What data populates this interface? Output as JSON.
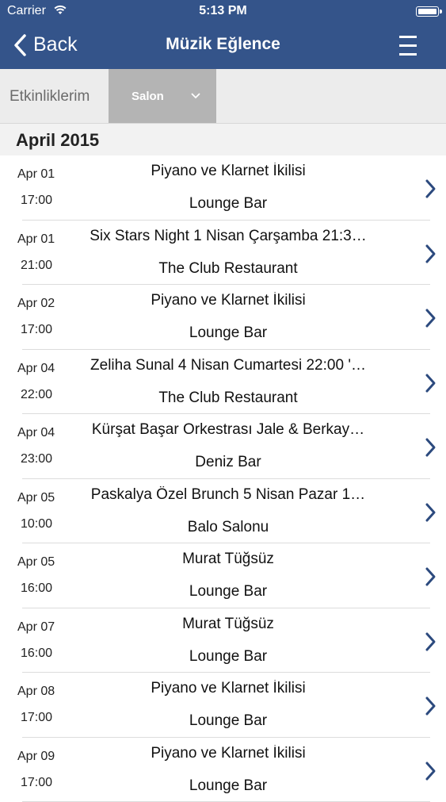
{
  "status_bar": {
    "carrier": "Carrier",
    "time": "5:13 PM"
  },
  "nav": {
    "back_label": "Back",
    "title": "Müzik Eğlence"
  },
  "tabs": {
    "etkinliklerim": "Etkinliklerim",
    "salon": "Salon"
  },
  "section": {
    "title": "April 2015"
  },
  "events": [
    {
      "date": "Apr 01",
      "time": "17:00",
      "name": "Piyano ve Klarnet İkilisi",
      "venue": "Lounge Bar"
    },
    {
      "date": "Apr 01",
      "time": "21:00",
      "name": "Six Stars Night 1 Nisan Çarşamba 21:3…",
      "venue": "The Club Restaurant"
    },
    {
      "date": "Apr 02",
      "time": "17:00",
      "name": "Piyano ve Klarnet İkilisi",
      "venue": "Lounge Bar"
    },
    {
      "date": "Apr 04",
      "time": "22:00",
      "name": "Zeliha Sunal 4 Nisan Cumartesi 22:00 '…",
      "venue": "The Club Restaurant"
    },
    {
      "date": "Apr 04",
      "time": "23:00",
      "name": "Kürşat Başar Orkestrası Jale & Berkay…",
      "venue": "Deniz Bar"
    },
    {
      "date": "Apr 05",
      "time": "10:00",
      "name": "Paskalya Özel Brunch 5 Nisan Pazar 1…",
      "venue": "Balo Salonu"
    },
    {
      "date": "Apr 05",
      "time": "16:00",
      "name": "Murat Tüğsüz",
      "venue": "Lounge Bar"
    },
    {
      "date": "Apr 07",
      "time": "16:00",
      "name": "Murat Tüğsüz",
      "venue": "Lounge Bar"
    },
    {
      "date": "Apr 08",
      "time": "17:00",
      "name": "Piyano ve Klarnet İkilisi",
      "venue": "Lounge Bar"
    },
    {
      "date": "Apr 09",
      "time": "17:00",
      "name": "Piyano ve Klarnet İkilisi",
      "venue": "Lounge Bar"
    }
  ],
  "colors": {
    "nav_bg": "#34548a",
    "chevron": "#2c4a7e",
    "salon_tab_bg": "#b4b4b4"
  },
  "icons": {
    "back": "chevron-left-icon",
    "menu": "hamburger-menu-icon",
    "row": "chevron-right-icon",
    "dropdown": "chevron-down-icon"
  }
}
